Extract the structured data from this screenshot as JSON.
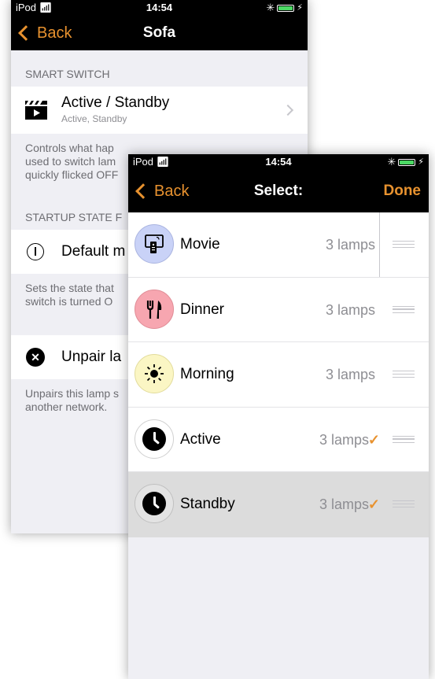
{
  "back_screen": {
    "status": {
      "carrier": "iPod",
      "time": "14:54"
    },
    "nav": {
      "back_label": "Back",
      "title": "Sofa"
    },
    "smart_switch": {
      "header": "SMART SWITCH",
      "cell_title": "Active / Standby",
      "cell_subtitle": "Active, Standby",
      "footer_lines": [
        "Controls what hap",
        "used to switch lam",
        "quickly flicked OFF"
      ]
    },
    "startup": {
      "header": "STARTUP STATE F",
      "cell_title": "Default m",
      "footer_lines": [
        "Sets the state that",
        "switch is turned O"
      ]
    },
    "unpair": {
      "cell_title": "Unpair la",
      "footer_lines": [
        "Unpairs this lamp s",
        "another network."
      ]
    }
  },
  "front_screen": {
    "status": {
      "carrier": "iPod",
      "time": "14:54"
    },
    "nav": {
      "back_label": "Back",
      "title": "Select:",
      "done_label": "Done"
    },
    "items": [
      {
        "name": "Movie",
        "lamps": "3 lamps",
        "checked": false,
        "icon": "remote-icon",
        "icon_bg": "#c9d2f7"
      },
      {
        "name": "Dinner",
        "lamps": "3 lamps",
        "checked": false,
        "icon": "fork-knife-icon",
        "icon_bg": "#f7a6b0"
      },
      {
        "name": "Morning",
        "lamps": "3 lamps",
        "checked": false,
        "icon": "sun-icon",
        "icon_bg": "#fbf6c4"
      },
      {
        "name": "Active",
        "lamps": "3 lamps",
        "checked": true,
        "icon": "clock-icon",
        "icon_bg": "#ffffff"
      },
      {
        "name": "Standby",
        "lamps": "3 lamps",
        "checked": true,
        "icon": "clock-icon",
        "icon_bg": "#e3e3e3"
      }
    ]
  },
  "colors": {
    "accent": "#e8922f",
    "navbar": "#000000",
    "battery": "#4cd964"
  }
}
